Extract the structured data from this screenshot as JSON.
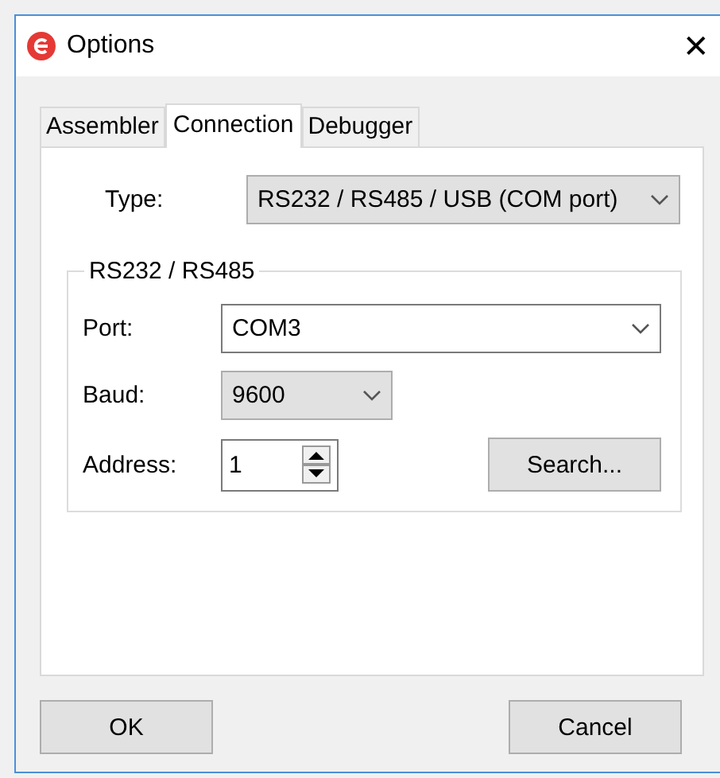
{
  "window": {
    "title": "Options",
    "close": "✕"
  },
  "tabs": [
    {
      "label": "Assembler",
      "selected": false
    },
    {
      "label": "Connection",
      "selected": true
    },
    {
      "label": "Debugger",
      "selected": false
    }
  ],
  "type": {
    "label": "Type:",
    "value": "RS232 / RS485 / USB (COM port)"
  },
  "group": {
    "title": "RS232 / RS485",
    "port": {
      "label": "Port:",
      "value": "COM3"
    },
    "baud": {
      "label": "Baud:",
      "value": "9600"
    },
    "address": {
      "label": "Address:",
      "value": "1"
    },
    "search_button": "Search..."
  },
  "buttons": {
    "ok": "OK",
    "cancel": "Cancel"
  }
}
